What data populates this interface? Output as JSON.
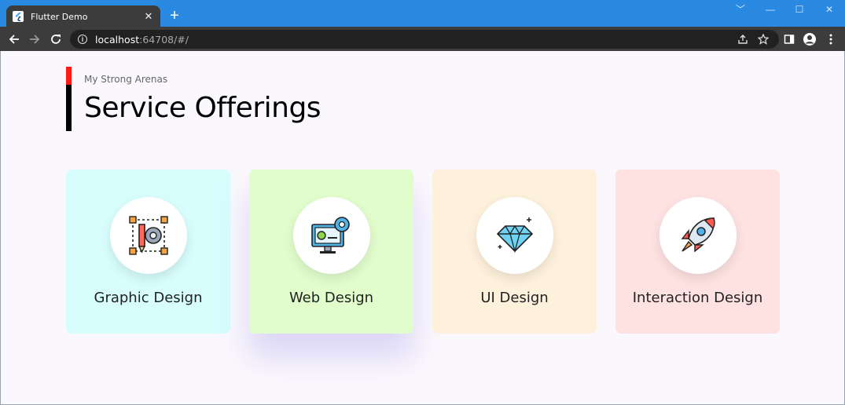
{
  "browser": {
    "tab_title": "Flutter Demo",
    "tab_close": "✕",
    "new_tab": "+",
    "url_host": "localhost",
    "url_rest": ":64708/#/",
    "window_controls": [
      "﹀",
      "—",
      "☐",
      "✕"
    ]
  },
  "page": {
    "kicker": "My Strong Arenas",
    "title": "Service Offerings",
    "accent_red": "#ff1a1a"
  },
  "services": [
    {
      "label": "Graphic Design",
      "bg": "#d7fdfd",
      "icon": "graphic-design-icon"
    },
    {
      "label": "Web Design",
      "bg": "#e1fdcc",
      "icon": "web-design-icon"
    },
    {
      "label": "UI Design",
      "bg": "#fef1dc",
      "icon": "diamond-icon"
    },
    {
      "label": "Interaction Design",
      "bg": "#fee2e2",
      "icon": "rocket-icon"
    }
  ]
}
